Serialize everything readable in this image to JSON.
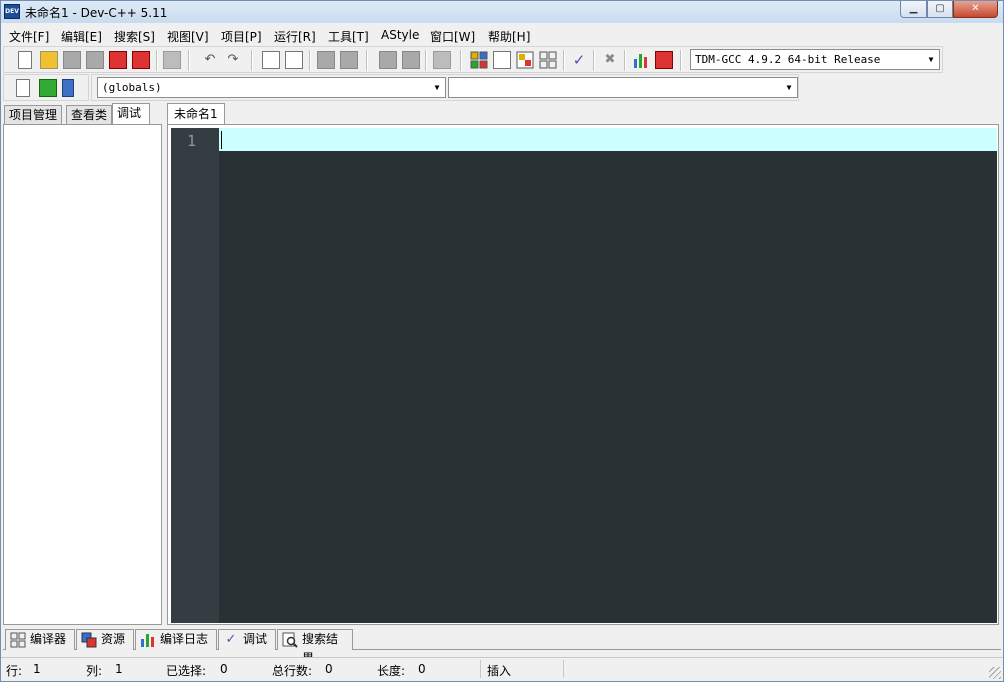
{
  "window": {
    "title": "未命名1 - Dev-C++ 5.11",
    "icon": "devcpp-app-icon",
    "controls": {
      "minimize": "minimize-icon",
      "maximize": "maximize-icon",
      "close": "close-icon"
    }
  },
  "menu": [
    {
      "label": "文件[F]"
    },
    {
      "label": "编辑[E]"
    },
    {
      "label": "搜索[S]"
    },
    {
      "label": "视图[V]"
    },
    {
      "label": "项目[P]"
    },
    {
      "label": "运行[R]"
    },
    {
      "label": "工具[T]"
    },
    {
      "label": "AStyle"
    },
    {
      "label": "窗口[W]"
    },
    {
      "label": "帮助[H]"
    }
  ],
  "toolbar": {
    "compiler": "TDM-GCC 4.9.2 64-bit Release",
    "class_combo": "(globals)",
    "member_combo": ""
  },
  "left_panel": {
    "tabs": [
      {
        "label": "项目管理"
      },
      {
        "label": "查看类"
      },
      {
        "label": "调试",
        "active": true
      }
    ]
  },
  "editor": {
    "tabs": [
      {
        "label": "未命名1",
        "active": true
      }
    ],
    "line_numbers": [
      "1"
    ],
    "colors": {
      "background": "#293134",
      "gutter": "#333d42",
      "current_line": "#ccffff"
    }
  },
  "bottom_tabs": [
    {
      "label": "编译器",
      "icon": "compiler-grid-icon"
    },
    {
      "label": "资源",
      "icon": "resources-icon"
    },
    {
      "label": "编译日志",
      "icon": "compile-log-chart-icon"
    },
    {
      "label": "调试",
      "icon": "debug-check-icon"
    },
    {
      "label": "搜索结果",
      "icon": "search-results-icon"
    }
  ],
  "status": {
    "row_label": "行:",
    "row_value": "1",
    "col_label": "列:",
    "col_value": "1",
    "sel_label": "已选择:",
    "sel_value": "0",
    "lines_label": "总行数:",
    "lines_value": "0",
    "length_label": "长度:",
    "length_value": "0",
    "mode": "插入"
  }
}
